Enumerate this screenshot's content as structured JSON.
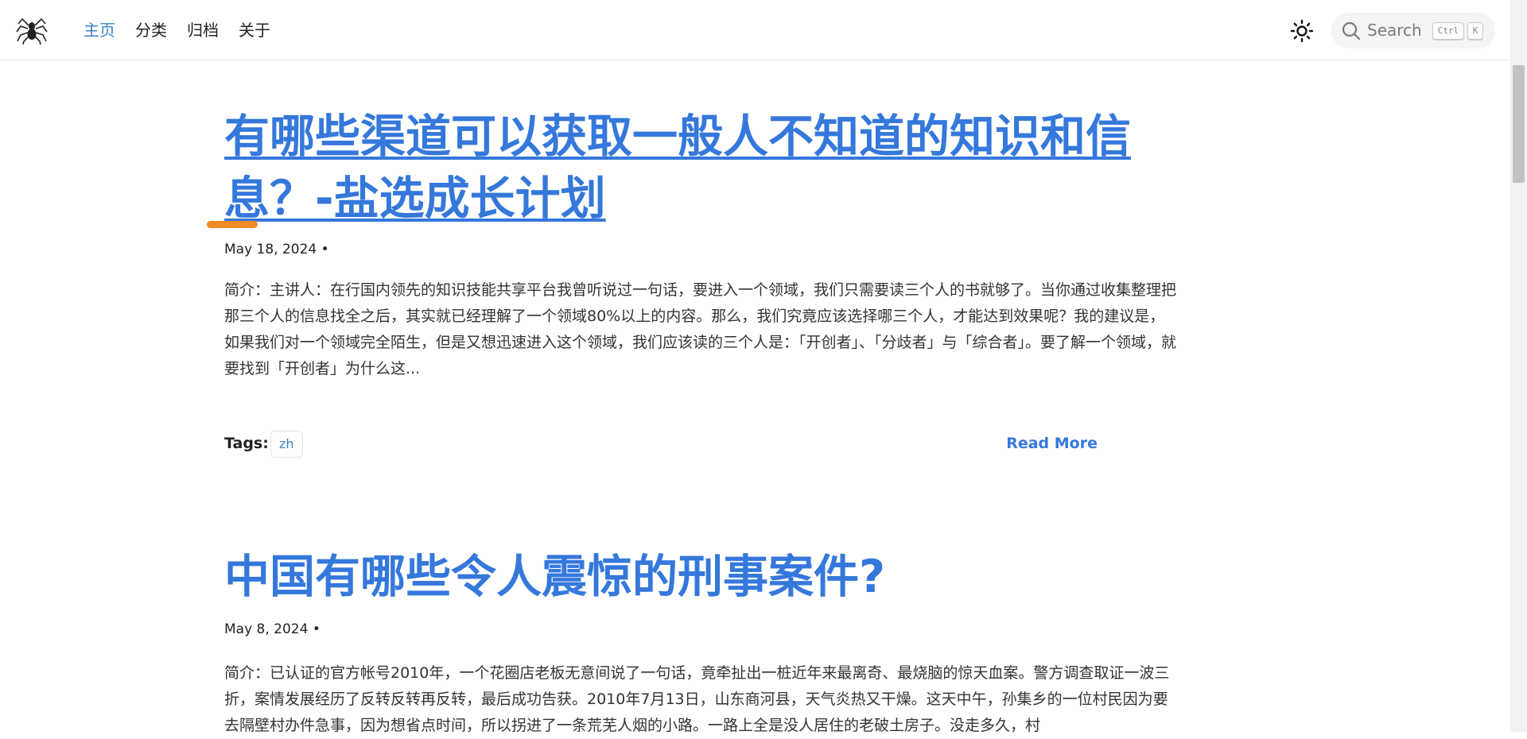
{
  "header": {
    "logo_icon": "spider-logo-icon",
    "nav": [
      {
        "label": "主页",
        "active": true
      },
      {
        "label": "分类",
        "active": false
      },
      {
        "label": "归档",
        "active": false
      },
      {
        "label": "关于",
        "active": false
      }
    ],
    "theme_icon": "sun-icon",
    "search": {
      "placeholder": "Search",
      "shortcut_ctrl": "Ctrl",
      "shortcut_key": "K"
    }
  },
  "posts": [
    {
      "title": "有哪些渠道可以获取一般人不知道的知识和信息？-盐选成长计划",
      "date": "May 18, 2024 •",
      "excerpt": "简介：主讲人：在行国内领先的知识技能共享平台我曾听说过一句话，要进入一个领域，我们只需要读三个人的书就够了。当你通过收集整理把那三个人的信息找全之后，其实就已经理解了一个领域80%以上的内容。那么，我们究竟应该选择哪三个人，才能达到效果呢？我的建议是，如果我们对一个领域完全陌生，但是又想迅速进入这个领域，我们应该读的三个人是：「开创者」、「分歧者」与「综合者」。要了解一个领域，就要找到「开创者」为什么这...",
      "tags_label": "Tags:",
      "tags": [
        "zh"
      ],
      "read_more": "Read More"
    },
    {
      "title": "中国有哪些令人震惊的刑事案件?",
      "date": "May 8, 2024 •",
      "excerpt": "简介：已认证的官方帐号2010年，一个花圈店老板无意间说了一句话，竟牵扯出一桩近年来最离奇、最烧脑的惊天血案。警方调查取证一波三折，案情发展经历了反转反转再反转，最后成功告获。2010年7月13日，山东商河县，天气炎热又干燥。这天中午，孙集乡的一位村民因为要去隔壁村办件急事，因为想省点时间，所以拐进了一条荒芜人烟的小路。一路上全是没人居住的老破土房子。没走多久，村"
    }
  ],
  "colors": {
    "accent": "#3578dc",
    "nav_active": "#3b82c4",
    "highlight": "#f08a24"
  }
}
